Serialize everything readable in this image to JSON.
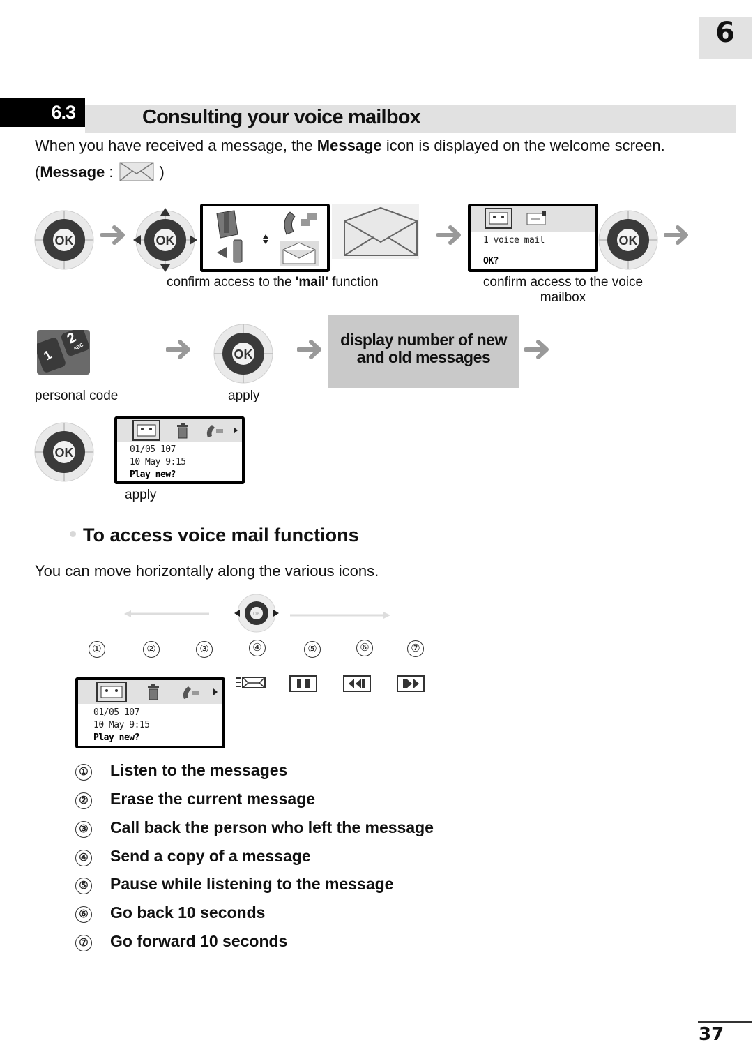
{
  "chapter": {
    "number": "6"
  },
  "section": {
    "number": "6.3",
    "title": "Consulting your voice mailbox"
  },
  "intro": {
    "before_bold": "When you have received a message, the ",
    "bold": "Message",
    "after_bold": " icon is displayed on the welcome screen.",
    "paren_open": "(",
    "paren_label": "Message",
    "paren_colon": " :",
    "paren_close": ")",
    "icon": "envelope-icon"
  },
  "step_row_1": {
    "caption_mail_pre": "confirm access to the ",
    "caption_mail_bold": "'mail'",
    "caption_mail_post": " function",
    "caption_voicemailbox": "confirm access to the voice mailbox",
    "ok_label": "OK",
    "menu_icons": [
      "phone-base-icon",
      "handset-forward-icon",
      "mobile-transfer-icon",
      "envelope-icon"
    ],
    "lcd_voicemail": {
      "line1": "1 voice mail",
      "line2": "OK?",
      "icons": [
        "cassette-icon",
        "sms-envelope-icon"
      ]
    }
  },
  "step_row_2": {
    "caption_code": "personal code",
    "caption_apply": "apply",
    "result_box": "display number of new and old messages",
    "result_box_line1": "display number of new",
    "result_box_line2": "and old messages",
    "keypad_keys": [
      "1",
      "2",
      "ABC"
    ]
  },
  "step_row_3": {
    "caption_apply": "apply",
    "lcd": {
      "line1": "01/05 107",
      "line2": "10 May 9:15",
      "line3": "Play new?",
      "icons": [
        "cassette-icon",
        "trash-icon",
        "callback-icon",
        "right-arrow-icon"
      ]
    }
  },
  "functions": {
    "heading": "To access voice mail functions",
    "description": "You can move horizontally along the various icons.",
    "numbers": [
      "①",
      "②",
      "③",
      "④",
      "⑤",
      "⑥",
      "⑦"
    ],
    "lcd": {
      "line1": "01/05 107",
      "line2": "10 May 9:15",
      "line3": "Play new?"
    },
    "icons": [
      "forward-message-icon",
      "pause-icon",
      "rewind-icon",
      "fast-forward-icon"
    ],
    "legend": [
      {
        "num": "①",
        "text": "Listen to the messages"
      },
      {
        "num": "②",
        "text": "Erase the current message"
      },
      {
        "num": "③",
        "text": "Call back the person who left the message"
      },
      {
        "num": "④",
        "text": "Send a copy of a message"
      },
      {
        "num": "⑤",
        "text": "Pause while listening to the message"
      },
      {
        "num": "⑥",
        "text": "Go back 10 seconds"
      },
      {
        "num": "⑦",
        "text": "Go forward 10 seconds"
      }
    ]
  },
  "page_number": "37"
}
